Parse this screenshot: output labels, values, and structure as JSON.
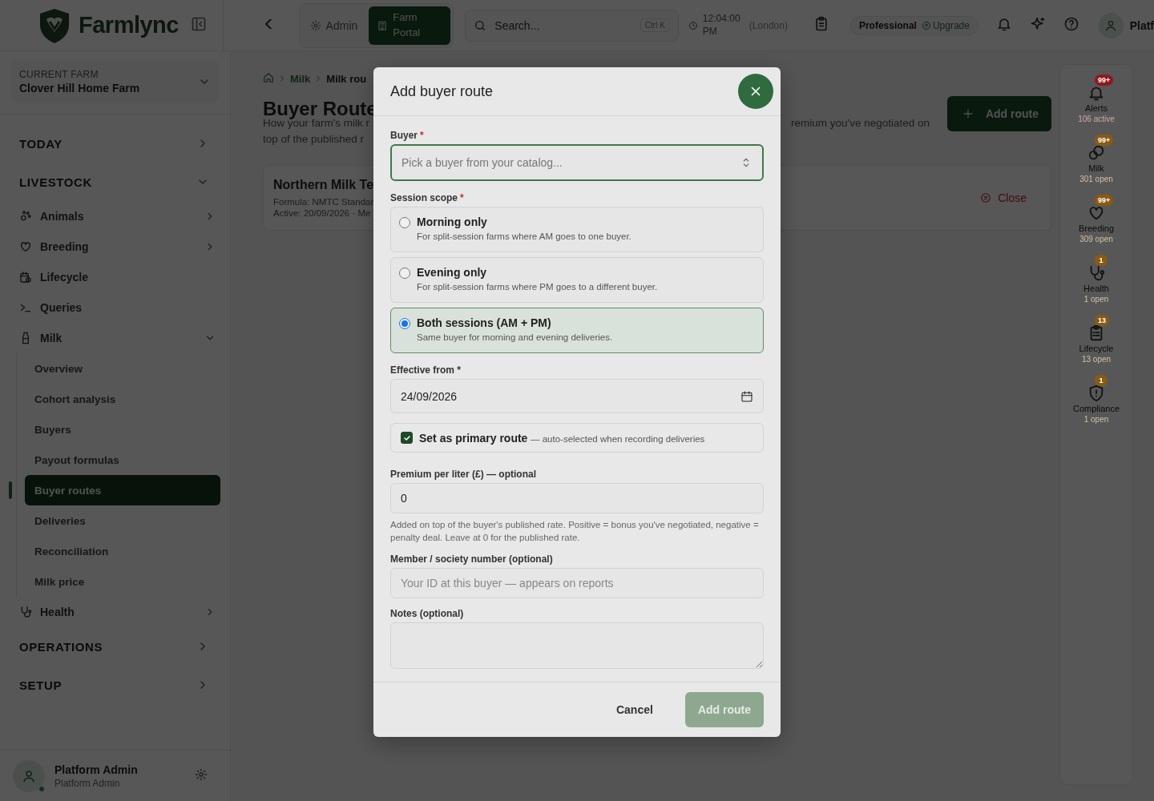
{
  "topbar": {
    "brand": "Farmlync",
    "portals": [
      {
        "label": "Admin",
        "selected": false
      },
      {
        "label": "Farm Portal",
        "selected": true
      }
    ],
    "search": {
      "placeholder": "Search...",
      "shortcut": "Ctrl K"
    },
    "clock": {
      "time": "12:04:00 PM",
      "zone": "(London)"
    },
    "plan": {
      "label": "Professional",
      "upgrade": "Upgrade"
    },
    "user": "Platf"
  },
  "sidebar": {
    "current_farm": {
      "label": "CURRENT FARM",
      "value": "Clover Hill Home Farm"
    },
    "sections": [
      {
        "label": "TODAY",
        "expanded": false
      },
      {
        "label": "LIVESTOCK",
        "expanded": true,
        "items": [
          {
            "label": "Animals",
            "expanded": false
          },
          {
            "label": "Breeding",
            "expanded": false
          },
          {
            "label": "Lifecycle"
          },
          {
            "label": "Queries"
          },
          {
            "label": "Milk",
            "expanded": true,
            "children": [
              {
                "label": "Overview",
                "selected": false
              },
              {
                "label": "Cohort analysis",
                "selected": false
              },
              {
                "label": "Buyers",
                "selected": false
              },
              {
                "label": "Payout formulas",
                "selected": false
              },
              {
                "label": "Buyer routes",
                "selected": true
              },
              {
                "label": "Deliveries",
                "selected": false
              },
              {
                "label": "Reconciliation",
                "selected": false
              },
              {
                "label": "Milk price",
                "selected": false
              }
            ]
          },
          {
            "label": "Health",
            "expanded": false
          }
        ]
      },
      {
        "label": "OPERATIONS",
        "expanded": false
      },
      {
        "label": "SETUP",
        "expanded": false
      }
    ],
    "user": {
      "name": "Platform Admin",
      "role": "Platform Admin",
      "online": true
    }
  },
  "page": {
    "breadcrumb": [
      "Milk",
      "Milk rou"
    ],
    "title": "Buyer Route",
    "description": [
      "How your farm's milk r",
      "top of the published r"
    ],
    "description_continued": "remium you've negotiated on",
    "add_button": "Add route",
    "routes": [
      {
        "name": "Northern Milk Te",
        "formula": "Formula: NMTC Standar",
        "active": "Active: 20/09/2026 · Me",
        "action": "Close"
      }
    ]
  },
  "rail": [
    {
      "label": "Alerts",
      "count": "106 active",
      "badge": "99+",
      "color": "#8c1b20"
    },
    {
      "label": "Milk",
      "count": "301 open",
      "badge": "99+",
      "color": "#8a5a12"
    },
    {
      "label": "Breeding",
      "count": "309 open",
      "badge": "99+",
      "color": "#8a5a12"
    },
    {
      "label": "Health",
      "count": "1 open",
      "badge": "1",
      "color": "#8a5a12"
    },
    {
      "label": "Lifecycle",
      "count": "13 open",
      "badge": "13",
      "color": "#8a5a12"
    },
    {
      "label": "Compliance",
      "count": "1 open",
      "badge": "1",
      "color": "#8a5a12"
    }
  ],
  "modal": {
    "title": "Add buyer route",
    "buyer": {
      "label": "Buyer",
      "required_mark": "*",
      "placeholder": "Pick a buyer from your catalog..."
    },
    "session_scope": {
      "label": "Session scope",
      "required_mark": "*",
      "options": [
        {
          "title": "Morning only",
          "description": "For split-session farms where AM goes to one buyer.",
          "selected": false
        },
        {
          "title": "Evening only",
          "description": "For split-session farms where PM goes to a different buyer.",
          "selected": false
        },
        {
          "title": "Both sessions (AM + PM)",
          "description": "Same buyer for morning and evening deliveries.",
          "selected": true
        }
      ]
    },
    "effective_from": {
      "label": "Effective from *",
      "value": "24/09/2026"
    },
    "primary": {
      "label": "Set as primary route",
      "hint": "— auto-selected when recording deliveries",
      "checked": true
    },
    "premium": {
      "label": "Premium per liter (£) — optional",
      "value": "0",
      "help": "Added on top of the buyer's published rate. Positive = bonus you've negotiated, negative = penalty deal. Leave at 0 for the published rate."
    },
    "member": {
      "label": "Member / society number (optional)",
      "placeholder": "Your ID at this buyer — appears on reports"
    },
    "notes": {
      "label": "Notes (optional)"
    },
    "buttons": [
      {
        "label": "Cancel",
        "kind": "secondary",
        "disabled": false
      },
      {
        "label": "Add route",
        "kind": "primary",
        "disabled": true
      }
    ]
  }
}
